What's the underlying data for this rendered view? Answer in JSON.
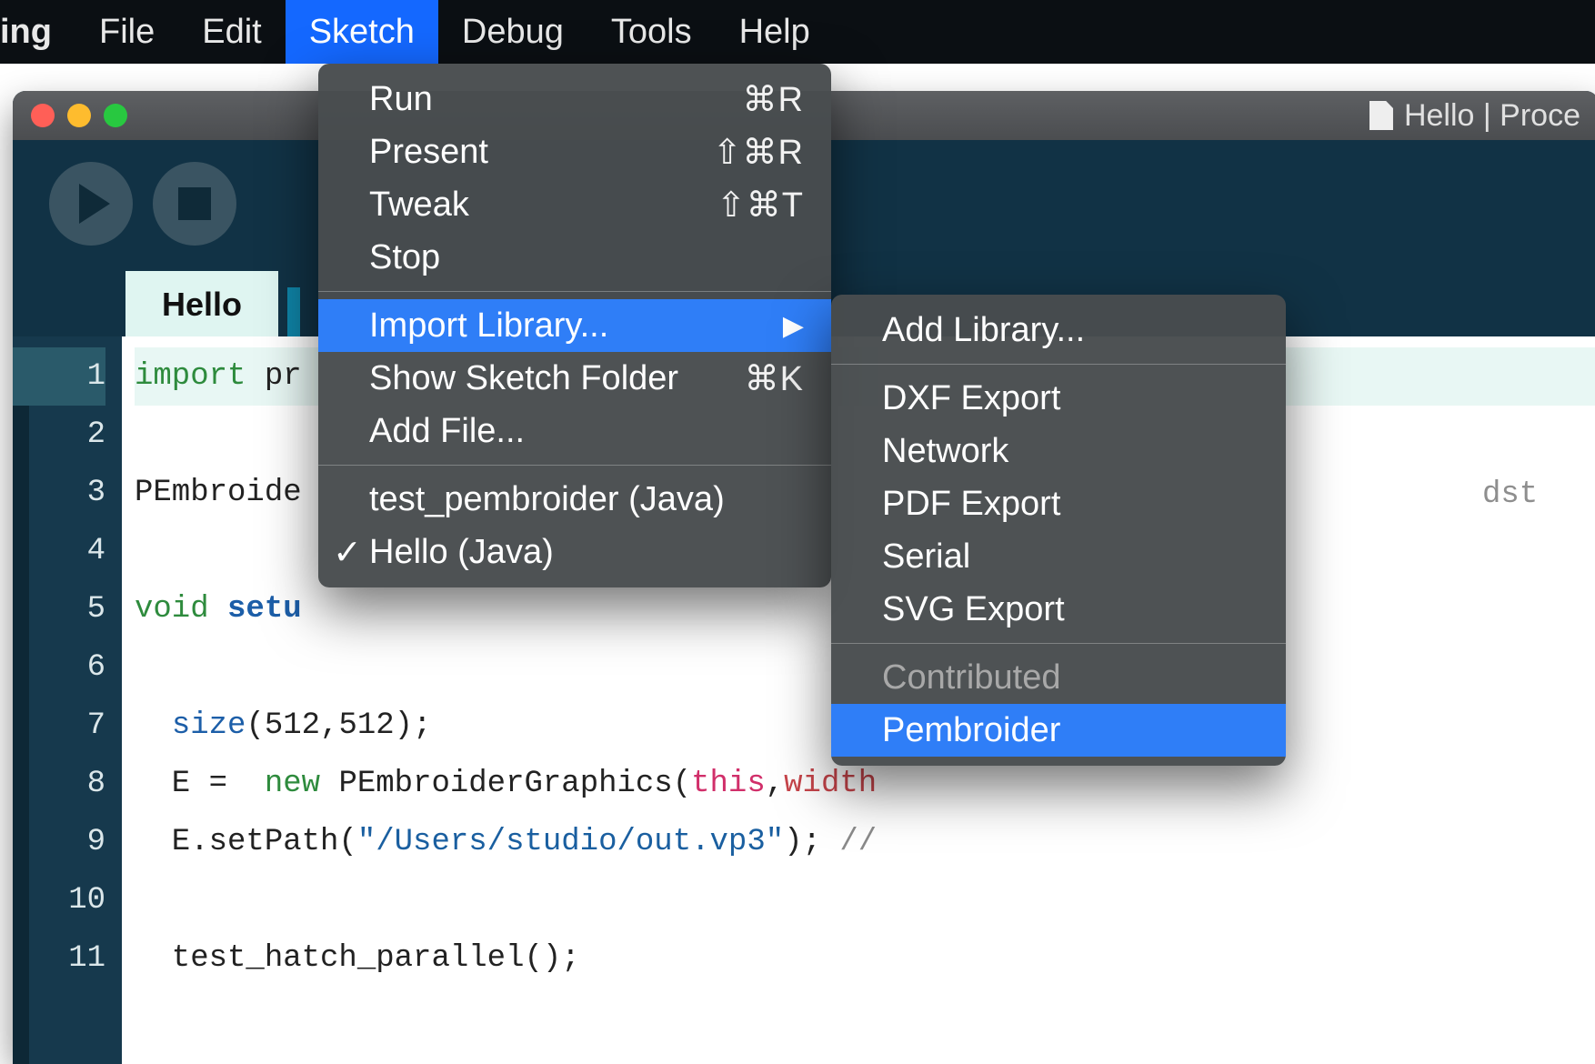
{
  "menubar": {
    "app": "ing",
    "items": [
      "File",
      "Edit",
      "Sketch",
      "Debug",
      "Tools",
      "Help"
    ],
    "active_index": 2
  },
  "window": {
    "title": "Hello | Proce"
  },
  "tabs": {
    "active": "Hello"
  },
  "code": {
    "lines": [
      {
        "n": 1,
        "segments": [
          [
            "kw-import",
            "import"
          ],
          [
            "",
            " pr"
          ]
        ],
        "hl": true
      },
      {
        "n": 2,
        "segments": []
      },
      {
        "n": 3,
        "segments": [
          [
            "",
            "PEmbroide"
          ]
        ]
      },
      {
        "n": 4,
        "segments": []
      },
      {
        "n": 5,
        "segments": [
          [
            "kw-void",
            "void"
          ],
          [
            "",
            " "
          ],
          [
            "kw-fn",
            "setu"
          ]
        ]
      },
      {
        "n": 6,
        "segments": []
      },
      {
        "n": 7,
        "segments": [
          [
            "",
            "  "
          ],
          [
            "kw-builtin",
            "size"
          ],
          [
            "",
            "(512,512);"
          ]
        ]
      },
      {
        "n": 8,
        "segments": [
          [
            "",
            "  E =  "
          ],
          [
            "kw-new",
            "new"
          ],
          [
            "",
            " PEmbroiderGraphics("
          ],
          [
            "kw-this",
            "this"
          ],
          [
            "",
            ","
          ],
          [
            "kw-prop",
            "width"
          ]
        ]
      },
      {
        "n": 9,
        "segments": [
          [
            "",
            "  E.setPath("
          ],
          [
            "str",
            "\"/Users/studio/out.vp3\""
          ],
          [
            "",
            "); "
          ],
          [
            "cm",
            "//"
          ]
        ]
      },
      {
        "n": 10,
        "segments": []
      },
      {
        "n": 11,
        "segments": [
          [
            "",
            "  test_hatch_parallel();"
          ]
        ]
      }
    ],
    "far_right_comment": "dst"
  },
  "sketch_menu": {
    "groups": [
      [
        {
          "label": "Run",
          "shortcut": "⌘R"
        },
        {
          "label": "Present",
          "shortcut": "⇧⌘R"
        },
        {
          "label": "Tweak",
          "shortcut": "⇧⌘T"
        },
        {
          "label": "Stop",
          "shortcut": ""
        }
      ],
      [
        {
          "label": "Import Library...",
          "submenu": true,
          "highlight": true
        },
        {
          "label": "Show Sketch Folder",
          "shortcut": "⌘K"
        },
        {
          "label": "Add File...",
          "shortcut": ""
        }
      ],
      [
        {
          "label": "test_pembroider (Java)",
          "shortcut": ""
        },
        {
          "label": "Hello (Java)",
          "shortcut": "",
          "checked": true
        }
      ]
    ]
  },
  "import_submenu": {
    "groups": [
      [
        {
          "label": "Add Library..."
        }
      ],
      [
        {
          "label": "DXF Export"
        },
        {
          "label": "Network"
        },
        {
          "label": "PDF Export"
        },
        {
          "label": "Serial"
        },
        {
          "label": "SVG Export"
        }
      ],
      [
        {
          "label": "Contributed",
          "disabled": true
        },
        {
          "label": "Pembroider",
          "highlight": true
        }
      ]
    ]
  }
}
